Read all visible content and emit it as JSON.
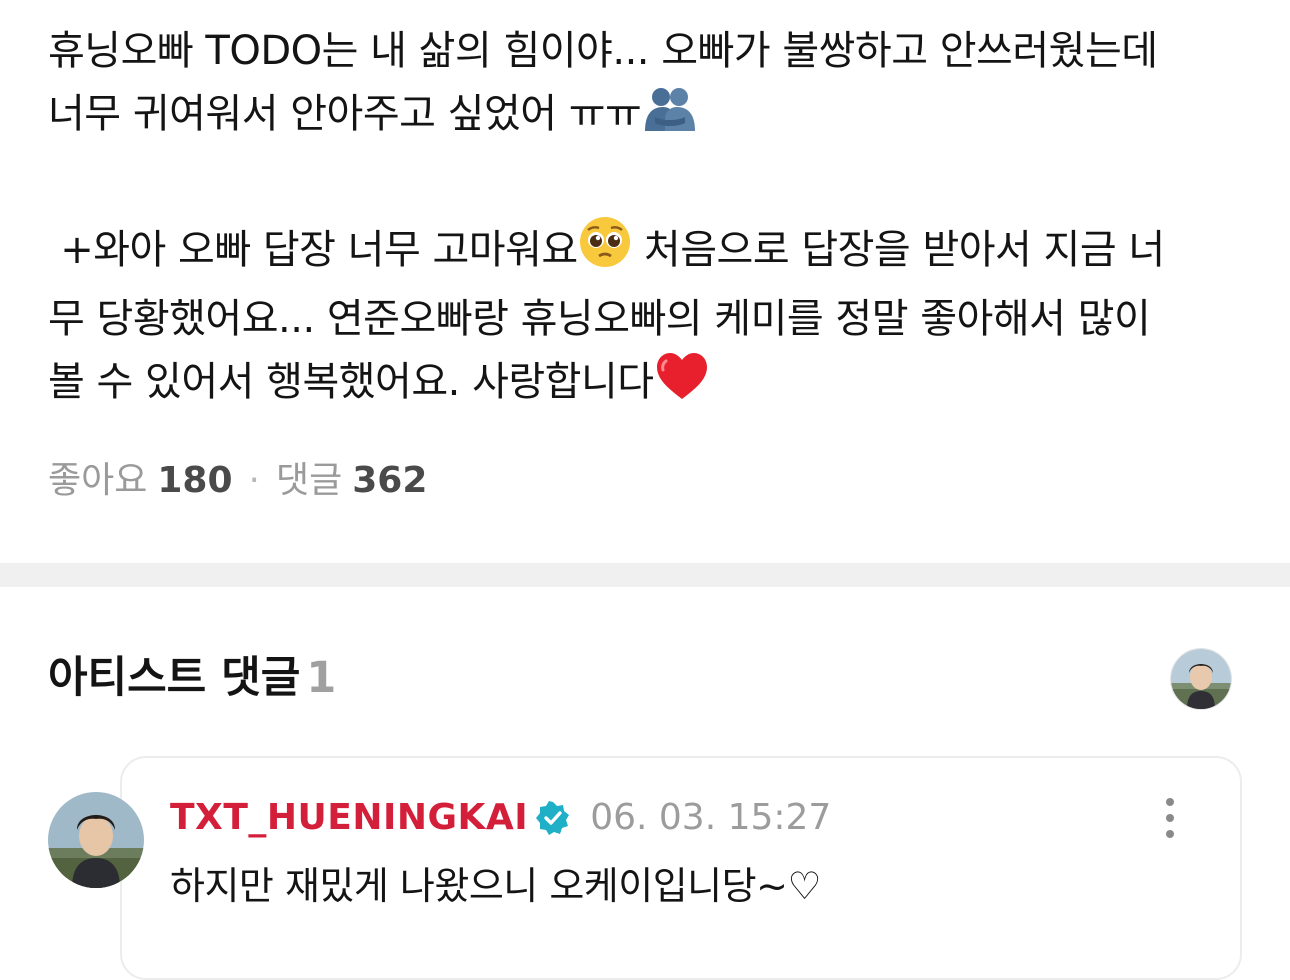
{
  "post": {
    "line1": "휴닝오빠 TODO는 내 삶의 힘이야... 오빠가 불쌍하고 안쓰러웠는데",
    "line2": "너무 귀여워서 안아주고 싶었어 ㅠㅠ",
    "line3a": " +와아 오빠 답장 너무 고마워요",
    "line3b": " 처음으로 답장을 받아서 지금 너",
    "line4": "무 당황했어요... 연준오빠랑 휴닝오빠의 케미를 정말 좋아해서 많이",
    "line5": "볼 수 있어서 행복했어요. 사랑합니다",
    "emojis": [
      "people-hugging-icon",
      "pleading-face-icon",
      "red-heart-icon"
    ]
  },
  "stats": {
    "likes_label": "좋아요",
    "likes_count": "180",
    "separator": "·",
    "comments_label": "댓글",
    "comments_count": "362"
  },
  "artist_section": {
    "title": "아티스트 댓글",
    "count": "1"
  },
  "comment": {
    "author": "TXT_HUENINGKAI",
    "verified_icon": "verified-badge-icon",
    "timestamp": "06. 03. 15:27",
    "text": "하지만 재밌게 나왔으니 오케이입니당~♡",
    "more_icon": "more-vertical-icon"
  },
  "colors": {
    "author": "#d41f3b",
    "verified": "#1fb0c8",
    "muted": "#9a9a9a",
    "separator": "#f0f0f0"
  }
}
